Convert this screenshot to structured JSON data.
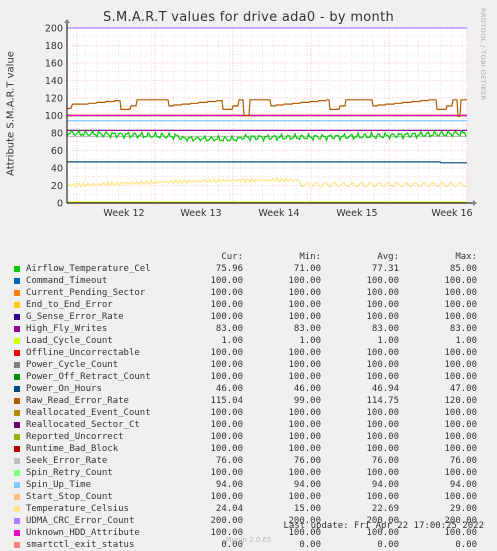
{
  "title": "S.M.A.R.T values for drive ada0 - by month",
  "side_label": "RRDTOOL / TOBI OETIKER",
  "footer": {
    "last_update": "Last update: Fri Apr 22 17:00:25 2022",
    "generator": "Munin 2.0.65"
  },
  "legend_header": {
    "cur": "Cur:",
    "min": "Min:",
    "avg": "Avg:",
    "max": "Max:"
  },
  "chart_data": {
    "type": "line",
    "ylabel": "Attribute S.M.A.R.T value",
    "ylim": [
      0,
      200
    ],
    "yticks": [
      0,
      20,
      40,
      60,
      80,
      100,
      120,
      140,
      160,
      180,
      200
    ],
    "x_ticks": [
      "Week 12",
      "Week 13",
      "Week 14",
      "Week 15",
      "Week 16"
    ],
    "series": [
      {
        "name": "Airflow_Temperature_Cel",
        "color": "#00cc00",
        "cur": "75.96",
        "min": "71.00",
        "avg": "77.31",
        "max": "85.00",
        "curve": "airflow"
      },
      {
        "name": "Command_Timeout",
        "color": "#0066b3",
        "cur": "100.00",
        "min": "100.00",
        "avg": "100.00",
        "max": "100.00",
        "value": 100
      },
      {
        "name": "Current_Pending_Sector",
        "color": "#ff8000",
        "cur": "100.00",
        "min": "100.00",
        "avg": "100.00",
        "max": "100.00",
        "value": 100
      },
      {
        "name": "End_to_End_Error",
        "color": "#ffcc00",
        "cur": "100.00",
        "min": "100.00",
        "avg": "100.00",
        "max": "100.00",
        "value": 100
      },
      {
        "name": "G_Sense_Error_Rate",
        "color": "#330099",
        "cur": "100.00",
        "min": "100.00",
        "avg": "100.00",
        "max": "100.00",
        "value": 100
      },
      {
        "name": "High_Fly_Writes",
        "color": "#990099",
        "cur": "83.00",
        "min": "83.00",
        "avg": "83.00",
        "max": "83.00",
        "value": 83
      },
      {
        "name": "Load_Cycle_Count",
        "color": "#ccff00",
        "cur": "1.00",
        "min": "1.00",
        "avg": "1.00",
        "max": "1.00",
        "value": 1
      },
      {
        "name": "Offline_Uncorrectable",
        "color": "#ff0000",
        "cur": "100.00",
        "min": "100.00",
        "avg": "100.00",
        "max": "100.00",
        "value": 100
      },
      {
        "name": "Power_Cycle_Count",
        "color": "#808080",
        "cur": "100.00",
        "min": "100.00",
        "avg": "100.00",
        "max": "100.00",
        "value": 100
      },
      {
        "name": "Power_Off_Retract_Count",
        "color": "#008f00",
        "cur": "100.00",
        "min": "100.00",
        "avg": "100.00",
        "max": "100.00",
        "value": 100
      },
      {
        "name": "Power_On_Hours",
        "color": "#00487d",
        "cur": "46.00",
        "min": "46.00",
        "avg": "46.94",
        "max": "47.00",
        "curve": "poweron"
      },
      {
        "name": "Raw_Read_Error_Rate",
        "color": "#b35a00",
        "cur": "115.04",
        "min": "99.00",
        "avg": "114.75",
        "max": "120.00",
        "curve": "rawread"
      },
      {
        "name": "Reallocated_Event_Count",
        "color": "#b38f00",
        "cur": "100.00",
        "min": "100.00",
        "avg": "100.00",
        "max": "100.00",
        "value": 100
      },
      {
        "name": "Reallocated_Sector_Ct",
        "color": "#6b006b",
        "cur": "100.00",
        "min": "100.00",
        "avg": "100.00",
        "max": "100.00",
        "value": 100
      },
      {
        "name": "Reported_Uncorrect",
        "color": "#8fb300",
        "cur": "100.00",
        "min": "100.00",
        "avg": "100.00",
        "max": "100.00",
        "value": 100
      },
      {
        "name": "Runtime_Bad_Block",
        "color": "#b30000",
        "cur": "100.00",
        "min": "100.00",
        "avg": "100.00",
        "max": "100.00",
        "value": 100
      },
      {
        "name": "Seek_Error_Rate",
        "color": "#bebebe",
        "cur": "76.00",
        "min": "76.00",
        "avg": "76.00",
        "max": "76.00",
        "value": 76
      },
      {
        "name": "Spin_Retry_Count",
        "color": "#80ff80",
        "cur": "100.00",
        "min": "100.00",
        "avg": "100.00",
        "max": "100.00",
        "value": 100
      },
      {
        "name": "Spin_Up_Time",
        "color": "#80c9ff",
        "cur": "94.00",
        "min": "94.00",
        "avg": "94.00",
        "max": "94.00",
        "value": 94
      },
      {
        "name": "Start_Stop_Count",
        "color": "#ffc080",
        "cur": "100.00",
        "min": "100.00",
        "avg": "100.00",
        "max": "100.00",
        "value": 100
      },
      {
        "name": "Temperature_Celsius",
        "color": "#ffe680",
        "cur": "24.04",
        "min": "15.00",
        "avg": "22.69",
        "max": "29.00",
        "curve": "temperature"
      },
      {
        "name": "UDMA_CRC_Error_Count",
        "color": "#aa80ff",
        "cur": "200.00",
        "min": "200.00",
        "avg": "200.00",
        "max": "200.00",
        "value": 200
      },
      {
        "name": "Unknown_HDD_Attribute",
        "color": "#ee00cc",
        "cur": "100.00",
        "min": "100.00",
        "avg": "100.00",
        "max": "100.00",
        "value": 100
      },
      {
        "name": "smartctl_exit_status",
        "color": "#ff8080",
        "cur": "0.00",
        "min": "0.00",
        "avg": "0.00",
        "max": "0.00",
        "value": 0
      }
    ]
  }
}
